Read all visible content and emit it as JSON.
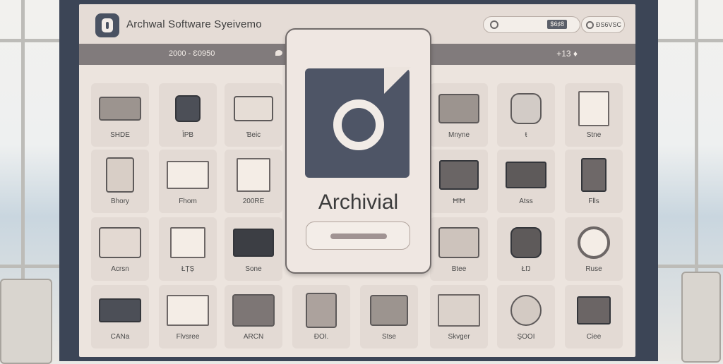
{
  "header": {
    "title": "Archwal Software Syeivemo",
    "search_tag": "$6♯8",
    "user_label": "ĐS6VSC"
  },
  "toolbar": {
    "left_text": "2000 - Ɛ0950",
    "right_text": "+13 ♦"
  },
  "modal": {
    "title": "Archivial"
  },
  "tiles": [
    {
      "label": "SHDE",
      "icon": "folder-icon"
    },
    {
      "label": "ĪPB",
      "icon": "chair-icon"
    },
    {
      "label": "Ɓeic",
      "icon": "document-tray-icon"
    },
    {
      "label": "Mnyne",
      "icon": "screen-icon"
    },
    {
      "label": "ŧ",
      "icon": "bag-icon"
    },
    {
      "label": "Stne",
      "icon": "document-icon"
    },
    {
      "label": "Bhory",
      "icon": "box-icon"
    },
    {
      "label": "Fhom",
      "icon": "printer-icon"
    },
    {
      "label": "200RE",
      "icon": "calendar-icon"
    },
    {
      "label": "Ħ!Ħ",
      "icon": "puzzle-icon"
    },
    {
      "label": "Atss",
      "icon": "stack-icon"
    },
    {
      "label": "Flls",
      "icon": "clipboard-icon"
    },
    {
      "label": "Acrsn",
      "icon": "folders-icon"
    },
    {
      "label": "ŁȚȘ",
      "icon": "hand-icon"
    },
    {
      "label": "Sone",
      "icon": "monitor-icon"
    },
    {
      "label": "Btee",
      "icon": "window-icon"
    },
    {
      "label": "ŁŊ",
      "icon": "disk-icon"
    },
    {
      "label": "Ruse",
      "icon": "button-icon"
    },
    {
      "label": "CANa",
      "icon": "drawer-icon"
    },
    {
      "label": "Flvsree",
      "icon": "file-list-icon"
    },
    {
      "label": "ARCN",
      "icon": "panel-icon"
    },
    {
      "label": "ĐOI.",
      "icon": "files-icon"
    },
    {
      "label": "Stse",
      "icon": "cards-icon"
    },
    {
      "label": "Skvger",
      "icon": "layers-icon"
    },
    {
      "label": "ŞOOI",
      "icon": "badge-icon"
    },
    {
      "label": "Ciee",
      "icon": "tools-icon"
    }
  ]
}
